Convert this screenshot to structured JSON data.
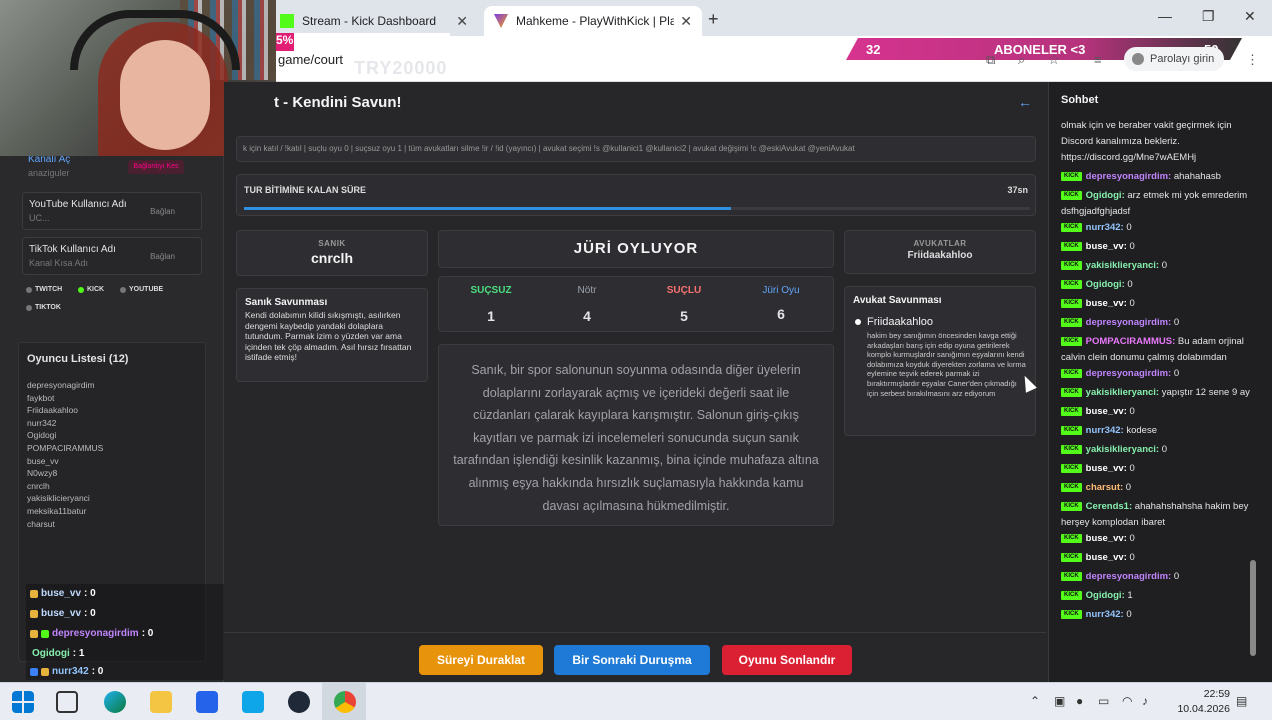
{
  "browser": {
    "tabs": [
      {
        "title": "Stream - Kick Dashboard",
        "active": false
      },
      {
        "title": "Mahkeme - PlayWithKick | Play",
        "active": true
      }
    ],
    "url": "game/court",
    "overlay_text": "TRY20000",
    "percent_overlay": "5%",
    "profile_label": "Parolayı girin"
  },
  "sub_goal": {
    "left": "32",
    "label": "ABONELER <3",
    "right": "50"
  },
  "left_panel": {
    "kick_card": {
      "title": "Kanalı Aç",
      "sub": "anaziguler",
      "action": "Bağlantıyı Kes"
    },
    "youtube_card": {
      "title": "YouTube Kullanıcı Adı",
      "sub": "UC...",
      "action": "Bağlan"
    },
    "tiktok_card": {
      "title": "TikTok Kullanıcı Adı",
      "sub": "Kanal Kısa Adı",
      "action": "Bağlan"
    },
    "platforms": [
      "TWITCH",
      "KICK",
      "YOUTUBE",
      "TIKTOK"
    ],
    "players_title": "Oyuncu Listesi (12)",
    "players": [
      "depresyonagirdim",
      "faykbot",
      "Friidaakahloo",
      "nurr342",
      "Ogidogi",
      "POMPACIRAMMUS",
      "buse_vv",
      "N0wzy8",
      "cnrclh",
      "yakisiklicieryanci",
      "meksika11batur",
      "charsut"
    ]
  },
  "mini_chat": [
    {
      "user": "buse_vv",
      "value": ": 0",
      "color": "#ffffff"
    },
    {
      "user": "buse_vv",
      "value": ": 0",
      "color": "#ffffff"
    },
    {
      "user": "depresyonagirdim",
      "value": ": 0",
      "color": "#c084fc"
    },
    {
      "user": "Ogidogi",
      "value": ": 1",
      "color": "#86efac"
    },
    {
      "user": "nurr342",
      "value": ": 0",
      "color": "#93c5fd"
    }
  ],
  "main": {
    "title": "t - Kendini Savun!",
    "commands": "k için katıl / !katıl | suçlu oyu 0 | suçsuz oyu 1 | tüm avukatları silme !ir / !id (yayıncı) | avukat seçimi !s @kullanici1 @kullanici2 | avukat değişimi !c @eskiAvukat @yeniAvukat",
    "timer_label": "TUR BİTİMİNE KALAN SÜRE",
    "timer_value": "37sn",
    "timer_progress": 0.62,
    "defendant_label": "SANIK",
    "defendant_name": "cnrclh",
    "jury_title": "JÜRİ OYLUYOR",
    "votes": [
      {
        "label": "SUÇSUZ",
        "value": "1",
        "color": "#4ade80"
      },
      {
        "label": "Nötr",
        "value": "4",
        "color": "#9ca3af"
      },
      {
        "label": "SUÇLU",
        "value": "5",
        "color": "#f87171"
      },
      {
        "label": "Jüri Oyu",
        "value": "6",
        "color": "#60a5fa"
      }
    ],
    "lawyers_label": "AVUKATLAR",
    "lawyer_name": "Friidaakahloo",
    "defendant_defense_title": "Sanık Savunması",
    "defendant_defense_text": "Kendi dolabımın kilidi sıkışmıştı, asılırken dengemi kaybedip yandaki dolaplara tutundum. Parmak izim o yüzden var ama içinden tek çöp almadım. Asıl hırsız fırsattan istifade etmiş!",
    "case_text": "Sanık, bir spor salonunun soyunma odasında diğer üyelerin dolaplarını zorlayarak açmış ve içerideki değerli saat ile cüzdanları çalarak kayıplara karışmıştır. Salonun giriş-çıkış kayıtları ve parmak izi incelemeleri sonucunda suçun sanık tarafından işlendiği kesinlik kazanmış, bina içinde muhafaza altına alınmış eşya hakkında hırsızlık suçlamasıyla hakkında kamu davası açılmasına hükmedilmiştir.",
    "lawyer_defense_title": "Avukat Savunması",
    "lawyer_defense_name": "Friidaakahloo",
    "lawyer_defense_text": "hakim bey sanığımın öncesinden kavga ettiği arkadaşları barış için edip oyuna getirilerek komplo kurmuşlardır sanığımın eşyalarını kendi dolabımıza koyduk diyerekten zorlama ve kırma eylemine teşvik ederek parmak izi bıraktırmışlardır eşyalar Caner'den çıkmadığı için serbest bırakılmasını arz ediyorum",
    "buttons": {
      "pause": "Süreyi Duraklat",
      "next": "Bir Sonraki Duruşma",
      "end": "Oyunu Sonlandır"
    }
  },
  "chat": {
    "title": "Sohbet",
    "intro": "olmak için ve beraber vakit geçirmek için Discord kanalımıza bekleriz. https://discord.gg/Mne7wAEMHj",
    "messages": [
      {
        "user": "depresyonagirdim",
        "text": " ahahahasb",
        "color": "#c084fc"
      },
      {
        "user": "Ogidogi",
        "text": " arz etmek mi yok emrederim dsfhgjadfghjadsf",
        "color": "#86efac"
      },
      {
        "user": "nurr342",
        "text": " 0",
        "color": "#93c5fd"
      },
      {
        "user": "buse_vv",
        "text": " 0",
        "color": "#ffffff"
      },
      {
        "user": "yakisiklieryanci",
        "text": " 0",
        "color": "#86efac"
      },
      {
        "user": "Ogidogi",
        "text": " 0",
        "color": "#86efac"
      },
      {
        "user": "buse_vv",
        "text": " 0",
        "color": "#ffffff"
      },
      {
        "user": "depresyonagirdim",
        "text": " 0",
        "color": "#c084fc"
      },
      {
        "user": "POMPACIRAMMUS",
        "text": " Bu adam orjinal calvin clein donumu çalmış dolabımdan",
        "color": "#e879f9"
      },
      {
        "user": "depresyonagirdim",
        "text": " 0",
        "color": "#c084fc"
      },
      {
        "user": "yakisiklieryanci",
        "text": " yapıştır 12 sene 9 ay",
        "color": "#86efac"
      },
      {
        "user": "buse_vv",
        "text": " 0",
        "color": "#ffffff"
      },
      {
        "user": "nurr342",
        "text": " kodese",
        "color": "#93c5fd"
      },
      {
        "user": "yakisiklieryanci",
        "text": " 0",
        "color": "#86efac"
      },
      {
        "user": "buse_vv",
        "text": " 0",
        "color": "#ffffff"
      },
      {
        "user": "charsut",
        "text": " 0",
        "color": "#fdba74"
      },
      {
        "user": "Cerends1",
        "text": " ahahahshahsha hakim bey herşey komplodan ibaret",
        "color": "#86efac"
      },
      {
        "user": "buse_vv",
        "text": " 0",
        "color": "#ffffff"
      },
      {
        "user": "buse_vv",
        "text": " 0",
        "color": "#ffffff"
      },
      {
        "user": "depresyonagirdim",
        "text": " 0",
        "color": "#c084fc"
      },
      {
        "user": "Ogidogi",
        "text": " 1",
        "color": "#86efac"
      },
      {
        "user": "nurr342",
        "text": " 0",
        "color": "#93c5fd"
      }
    ]
  },
  "taskbar": {
    "time": "22:59",
    "date": "10.04.2026"
  }
}
